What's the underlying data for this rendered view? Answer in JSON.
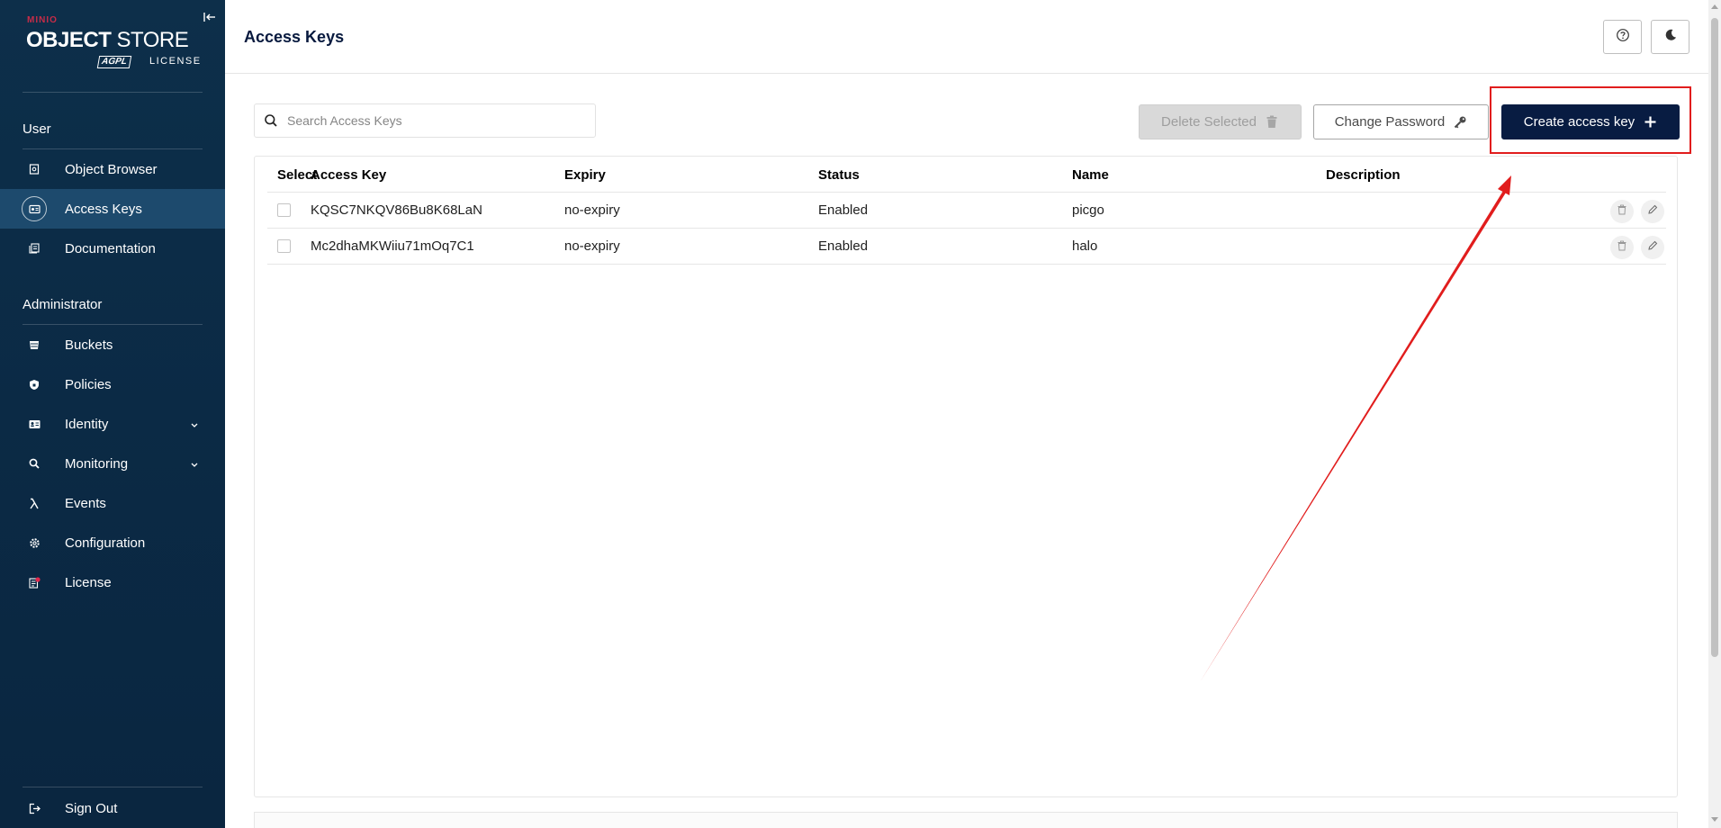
{
  "sidebar": {
    "logo": {
      "brand": "MINIO",
      "product_bold": "OBJECT",
      "product_light": " STORE",
      "badge": "AGPL",
      "license_text": "LICENSE"
    },
    "user_section": "User",
    "user_items": [
      {
        "label": "Object Browser",
        "icon": "object-browser-icon"
      },
      {
        "label": "Access Keys",
        "icon": "access-keys-icon",
        "active": true
      },
      {
        "label": "Documentation",
        "icon": "documentation-icon"
      }
    ],
    "admin_section": "Administrator",
    "admin_items": [
      {
        "label": "Buckets",
        "icon": "bucket-icon"
      },
      {
        "label": "Policies",
        "icon": "policy-shield-icon"
      },
      {
        "label": "Identity",
        "icon": "identity-icon",
        "expandable": true
      },
      {
        "label": "Monitoring",
        "icon": "monitoring-icon",
        "expandable": true
      },
      {
        "label": "Events",
        "icon": "lambda-icon"
      },
      {
        "label": "Configuration",
        "icon": "gear-icon"
      },
      {
        "label": "License",
        "icon": "license-icon"
      }
    ],
    "sign_out": "Sign Out"
  },
  "header": {
    "title": "Access Keys",
    "help_icon": "help-circle-icon",
    "theme_icon": "moon-icon"
  },
  "toolbar": {
    "search_placeholder": "Search Access Keys",
    "search_value": "",
    "delete_label": "Delete Selected",
    "change_password_label": "Change Password",
    "create_label": "Create access key"
  },
  "table": {
    "columns": [
      "Select",
      "Access Key",
      "Expiry",
      "Status",
      "Name",
      "Description"
    ],
    "rows": [
      {
        "access_key": "KQSC7NKQV86Bu8K68LaN",
        "expiry": "no-expiry",
        "status": "Enabled",
        "name": "picgo",
        "description": ""
      },
      {
        "access_key": "Mc2dhaMKWiiu71mOq7C1",
        "expiry": "no-expiry",
        "status": "Enabled",
        "name": "halo",
        "description": ""
      }
    ]
  },
  "colors": {
    "sidebar_bg": "#0d2f4a",
    "sidebar_active": "#1d4a6d",
    "primary_button": "#081c42",
    "annotation": "#e11d1d",
    "brand_red": "#c72c48"
  }
}
